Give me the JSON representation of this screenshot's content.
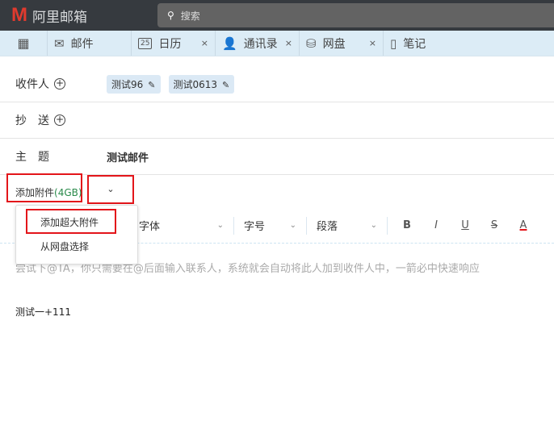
{
  "header": {
    "logo_mark": "M",
    "logo_text": "阿里邮箱",
    "search_placeholder": "搜索"
  },
  "tabs": [
    {
      "label": "邮件",
      "icon": "mail-icon"
    },
    {
      "label": "日历",
      "icon": "calendar-icon",
      "day": "25"
    },
    {
      "label": "通讯录",
      "icon": "contacts-icon"
    },
    {
      "label": "网盘",
      "icon": "drive-icon"
    },
    {
      "label": "笔记",
      "icon": "note-icon"
    }
  ],
  "close_glyph": "×",
  "compose": {
    "to_label": "收件人",
    "recipients": [
      "测试96",
      "测试0613"
    ],
    "cc_label": "抄　送",
    "subject_label": "主　题",
    "subject": "测试邮件",
    "attach_label": "添加附件",
    "attach_size": "(4GB)",
    "attach_menu": [
      "添加超大附件",
      "从网盘选择"
    ],
    "toolbar": {
      "font": "字体",
      "size": "字号",
      "paragraph": "段落",
      "bold": "B",
      "italic": "I",
      "underline": "U",
      "strike": "S",
      "color": "A"
    },
    "placeholder": "尝试下@TA，你只需要在@后面输入联系人，系统就会自动将此人加到收件人中，一箭必中快速响应",
    "body": "测试一+111"
  }
}
